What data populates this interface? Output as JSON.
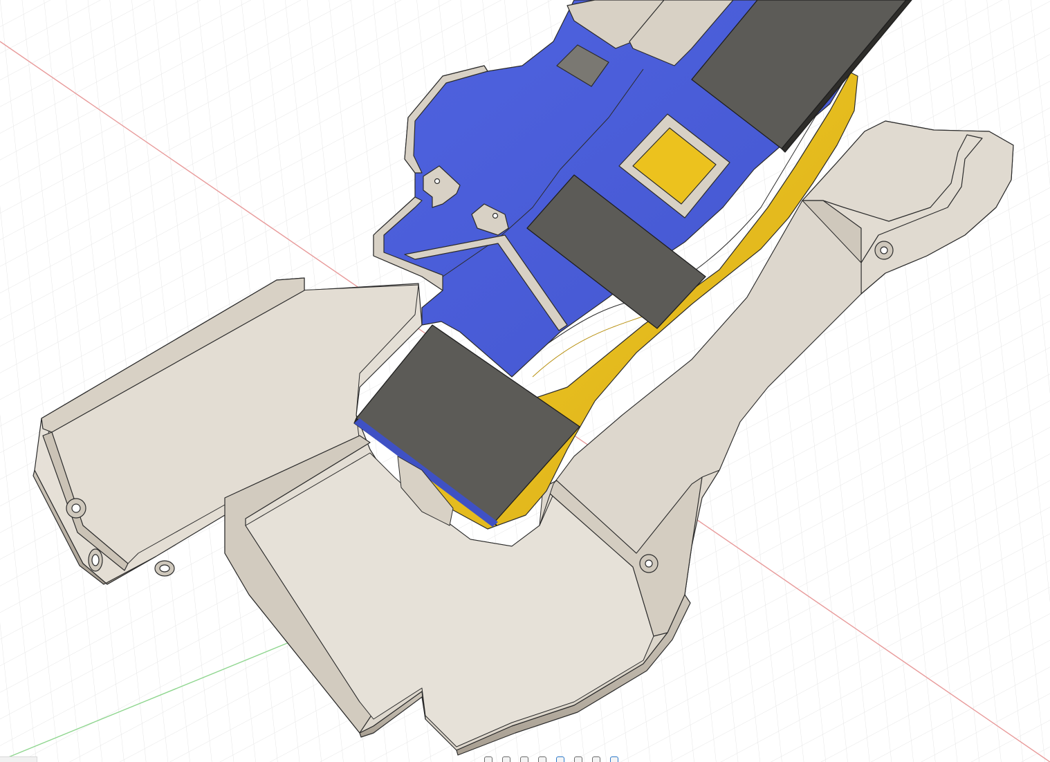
{
  "app": {
    "canvas": "3d-viewport",
    "view": "perspective"
  },
  "colors": {
    "background": "#ffffff",
    "grid_minor": "#e3e3e3",
    "grid_major": "#cfcfcf",
    "axis_x": "#e05a5a",
    "axis_y": "#4fbf4f",
    "shell_light": "#e6e1d9",
    "shell_top": "#ddd6cb",
    "shell_shadow": "#b5ada1",
    "insert_blue": "#4a5ed8",
    "insert_yellow": "#ecc21e",
    "pad_dark": "#5c5b57",
    "edge": "#2b2b2b"
  },
  "navigation_toolbar": {
    "icons": [
      "orbit-icon",
      "pan-icon",
      "look-at-icon",
      "zoom-icon",
      "fit-icon",
      "display-settings-icon",
      "grid-settings-icon",
      "viewports-icon"
    ]
  }
}
